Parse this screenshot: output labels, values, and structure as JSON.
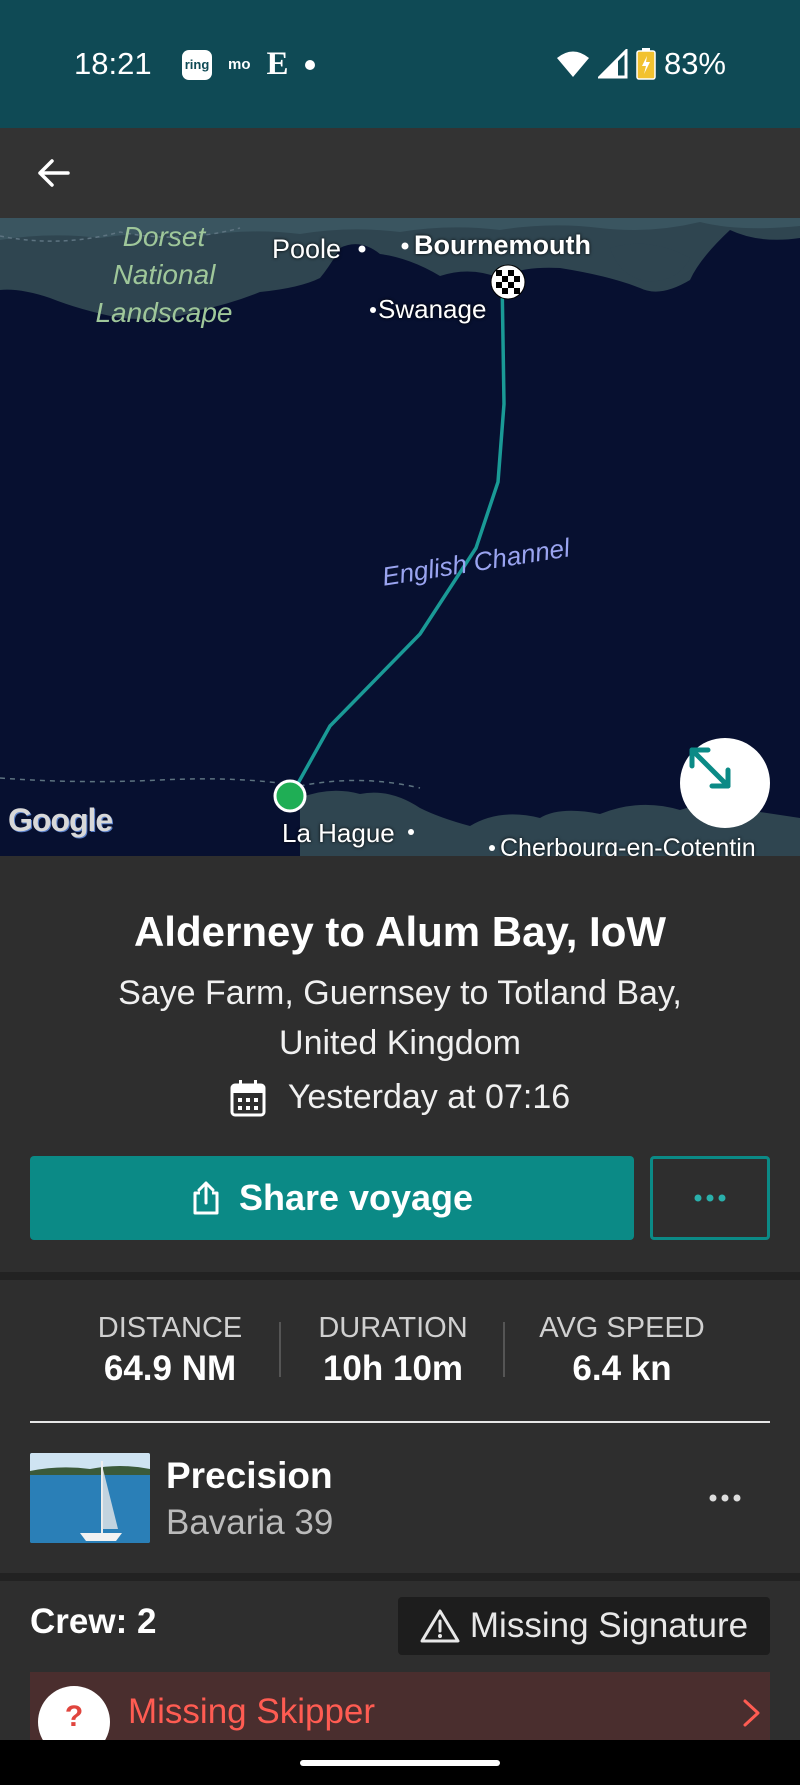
{
  "status_bar": {
    "time": "18:21",
    "notification_icons": [
      "ring-icon",
      "mo-icon",
      "e-icon",
      "dot-icon"
    ],
    "ring_text": "ring",
    "mo_text": "mo",
    "e_text": "E",
    "battery_percent": "83%"
  },
  "app_bar": {
    "back_icon": "arrow-left-icon"
  },
  "map": {
    "labels": {
      "dorset": "Dorset\nNational\nLandscape",
      "poole": "Poole",
      "bournemouth": "Bournemouth",
      "swanage": "Swanage",
      "channel": "English Channel",
      "la_hague": "La Hague",
      "cherbourg": "Cherbourg-en-Cotentin"
    },
    "attribution": "Google",
    "route_color": "#1a9a96",
    "start_marker_color": "#1fae55",
    "finish_marker": "checkered-flag-icon",
    "expand_icon": "expand-arrows-icon"
  },
  "voyage": {
    "title": "Alderney to Alum Bay, IoW",
    "route": "Saye Farm, Guernsey to Totland Bay, United Kingdom",
    "date": "Yesterday at 07:16",
    "share_label": "Share voyage",
    "accent_color": "#0b8a86"
  },
  "stats": {
    "distance_label": "DISTANCE",
    "distance_value": "64.9 NM",
    "duration_label": "DURATION",
    "duration_value": "10h 10m",
    "speed_label": "AVG SPEED",
    "speed_value": "6.4 kn"
  },
  "boat": {
    "name": "Precision",
    "model": "Bavaria 39"
  },
  "crew": {
    "title": "Crew: 2",
    "warning_label": "Missing Signature",
    "skipper_label": "Missing Skipper",
    "skipper_avatar_text": "?"
  }
}
